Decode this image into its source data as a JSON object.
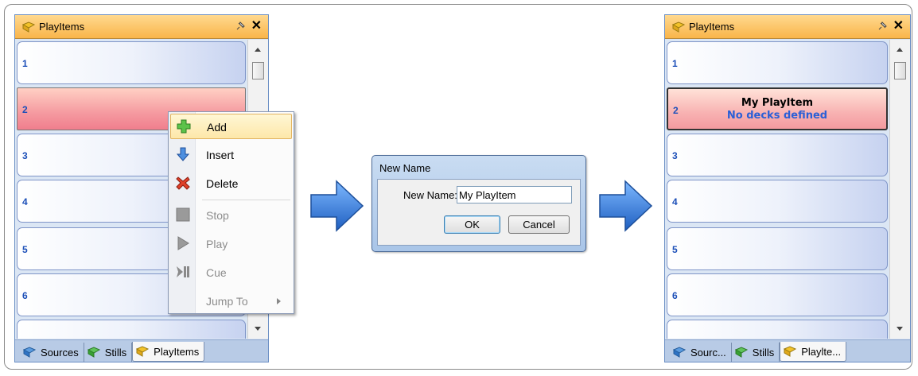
{
  "colors": {
    "title_bar": "#f9b54a",
    "panel_bg": "#dbe6f4",
    "row_selected": "#f07e8d",
    "number_blue": "#1c4fb8",
    "subtitle_blue": "#2a5fd6",
    "arrow_blue": "#2f7fd8"
  },
  "left_panel": {
    "title": "PlayItems",
    "rows": [
      "1",
      "2",
      "3",
      "4",
      "5",
      "6"
    ],
    "tabs": [
      "Sources",
      "Stills",
      "PlayItems"
    ]
  },
  "context_menu": {
    "items": [
      {
        "label": "Add",
        "icon": "add-icon"
      },
      {
        "label": "Insert",
        "icon": "insert-arrow-icon"
      },
      {
        "label": "Delete",
        "icon": "delete-x-icon"
      },
      {
        "label": "Stop",
        "icon": "stop-icon"
      },
      {
        "label": "Play",
        "icon": "play-icon"
      },
      {
        "label": "Cue",
        "icon": "cue-icon"
      },
      {
        "label": "Jump To",
        "icon": "submenu-arrow-icon"
      }
    ]
  },
  "dialog": {
    "title": "New Name",
    "label": "New Name:",
    "value": "My PlayItem",
    "ok": "OK",
    "cancel": "Cancel"
  },
  "right_panel": {
    "title": "PlayItems",
    "rows": [
      "1",
      "2",
      "3",
      "4",
      "5",
      "6"
    ],
    "item_title": "My PlayItem",
    "item_subtitle": "No decks defined",
    "tabs": [
      "Sourc...",
      "Stills",
      "Playlte..."
    ]
  }
}
